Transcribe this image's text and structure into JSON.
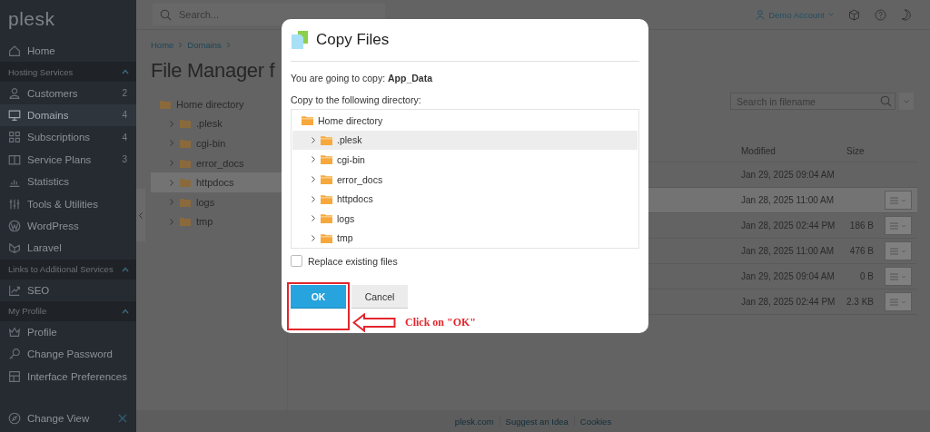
{
  "sidebar": {
    "logo": "plesk",
    "items": [
      {
        "kind": "item",
        "label": "Home",
        "selected": false
      },
      {
        "kind": "section",
        "label": "Hosting Services",
        "expanded": true
      },
      {
        "kind": "item",
        "label": "Customers",
        "count": "2",
        "selected": false
      },
      {
        "kind": "item",
        "label": "Domains",
        "count": "4",
        "selected": true
      },
      {
        "kind": "item",
        "label": "Subscriptions",
        "count": "4",
        "selected": false
      },
      {
        "kind": "item",
        "label": "Service Plans",
        "count": "3",
        "selected": false
      },
      {
        "kind": "item",
        "label": "Statistics",
        "selected": false
      },
      {
        "kind": "item",
        "label": "Tools & Utilities",
        "selected": false
      },
      {
        "kind": "item",
        "label": "WordPress",
        "selected": false
      },
      {
        "kind": "item",
        "label": "Laravel",
        "selected": false
      },
      {
        "kind": "section",
        "label": "Links to Additional Services",
        "expanded": true
      },
      {
        "kind": "item",
        "label": "SEO",
        "selected": false
      },
      {
        "kind": "section",
        "label": "My Profile",
        "expanded": true
      },
      {
        "kind": "item",
        "label": "Profile",
        "selected": false
      },
      {
        "kind": "item",
        "label": "Change Password",
        "selected": false
      },
      {
        "kind": "item",
        "label": "Interface Preferences",
        "selected": false
      }
    ],
    "bottom_item": {
      "label": "Change View"
    }
  },
  "topbar": {
    "search": {
      "placeholder": "Search..."
    },
    "user": "Demo Account"
  },
  "breadcrumbs": [
    "Home",
    "Domains"
  ],
  "title": "File Manager f",
  "tree": [
    {
      "label": "Home directory",
      "selected": false,
      "children": [
        {
          "label": ".plesk",
          "expanded": false,
          "selected": false
        },
        {
          "label": "cgi-bin",
          "expanded": false,
          "selected": false
        },
        {
          "label": "error_docs",
          "expanded": false,
          "selected": false
        },
        {
          "label": "httpdocs",
          "expanded": false,
          "selected": true
        },
        {
          "label": "logs",
          "expanded": false,
          "selected": false
        },
        {
          "label": "tmp",
          "expanded": false,
          "selected": false
        }
      ]
    }
  ],
  "file_search": {
    "placeholder": "Search in filename"
  },
  "table": {
    "columns": [
      "Modified",
      "Size"
    ],
    "rows": [
      {
        "modified": "Jan 29, 2025 09:04 AM",
        "selected": false,
        "actions": false
      },
      {
        "modified": "Jan 28, 2025 11:00 AM",
        "selected": true,
        "actions": true
      },
      {
        "modified": "Jan 28, 2025 02:44 PM",
        "size": "186 B",
        "selected": false,
        "actions": true
      },
      {
        "modified": "Jan 28, 2025 11:00 AM",
        "size": "476 B",
        "selected": false,
        "actions": true
      },
      {
        "modified": "Jan 29, 2025 09:04 AM",
        "size": "0 B",
        "selected": false,
        "actions": true
      },
      {
        "modified": "Jan 28, 2025 02:44 PM",
        "size": "2.3 KB",
        "selected": false,
        "actions": true
      }
    ]
  },
  "footer": [
    "plesk.com",
    "Suggest an Idea",
    "Cookies"
  ],
  "dialog": {
    "title": "Copy Files",
    "message": "You are going to copy: **App_Data**",
    "destination_label": "Copy to the following directory:",
    "tree": [
      {
        "label": "Home directory",
        "selected": false,
        "children": [
          {
            "label": ".plesk",
            "expanded": false,
            "selected": true
          },
          {
            "label": "cgi-bin",
            "expanded": false,
            "selected": false
          },
          {
            "label": "error_docs",
            "expanded": false,
            "selected": false
          },
          {
            "label": "httpdocs",
            "expanded": false,
            "selected": false
          },
          {
            "label": "logs",
            "expanded": false,
            "selected": false
          },
          {
            "label": "tmp",
            "expanded": false,
            "selected": false
          }
        ]
      }
    ],
    "checkbox": {
      "label": "Replace existing files",
      "checked": false
    },
    "buttons": [
      {
        "label": "OK",
        "kind": "primary"
      },
      {
        "label": "Cancel",
        "kind": "secondary"
      }
    ],
    "annotation": {
      "text": "Click on \"OK\""
    }
  }
}
